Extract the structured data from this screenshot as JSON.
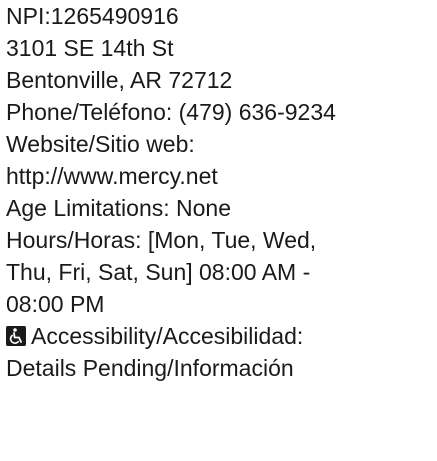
{
  "provider": {
    "npi": "NPI:1265490916",
    "address_line1": "3101 SE 14th St",
    "address_line2": "Bentonville, AR 72712",
    "phone": "Phone/Teléfono: (479) 636-9234",
    "website_label": "Website/Sitio web:",
    "website_url": "http://www.mercy.net",
    "age_limitations": "Age Limitations: None",
    "hours_line1": "Hours/Horas: [Mon, Tue, Wed,",
    "hours_line2": "Thu, Fri, Sat, Sun] 08:00 AM -",
    "hours_line3": "08:00 PM",
    "accessibility_icon": "wheelchair-icon",
    "accessibility_label": "Accessibility/Accesibilidad:",
    "accessibility_value": "Details Pending/Información"
  }
}
